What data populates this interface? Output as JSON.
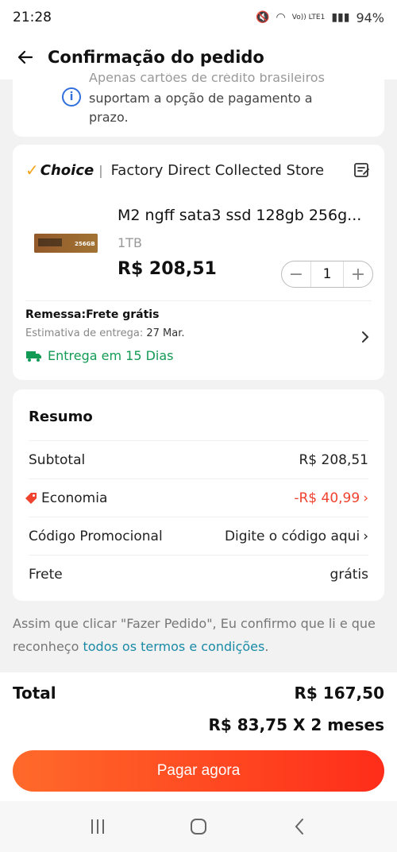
{
  "status_bar": {
    "time": "21:28",
    "network": "Vo)) LTE1",
    "battery": "94%"
  },
  "header": {
    "title": "Confirmação do pedido",
    "back_icon": "arrow-left-icon"
  },
  "notice": {
    "text_clipped": "Apenas cartões de crédito brasileiros",
    "text": "suportam a opção de pagamento a prazo.",
    "icon": "info-icon"
  },
  "store": {
    "badge": "Choice",
    "name": "Factory Direct Collected Store",
    "edit_icon": "note-edit-icon"
  },
  "product": {
    "title": "M2 ngff sata3 ssd 128gb 256g...",
    "variant": "1TB",
    "price": "R$ 208,51",
    "quantity": "1",
    "image_label": "256GB"
  },
  "shipping": {
    "label": "Remessa:Frete grátis",
    "estimate_label": "Estimativa de entrega:",
    "estimate_date": "27 Mar.",
    "delivery_days": "Entrega em 15 Dias"
  },
  "summary": {
    "title": "Resumo",
    "subtotal_label": "Subtotal",
    "subtotal_value": "R$ 208,51",
    "savings_label": "Economia",
    "savings_value": "-R$ 40,99",
    "promo_label": "Código Promocional",
    "promo_value": "Digite o código aqui",
    "freight_label": "Frete",
    "freight_value": "grátis"
  },
  "terms": {
    "text": "Assim que clicar \"Fazer Pedido\", Eu confirmo que li e que reconheço",
    "link": "todos os termos e condições",
    "end": "."
  },
  "footer": {
    "total_label": "Total",
    "total_value": "R$ 167,50",
    "installment": "R$ 83,75 X 2 meses",
    "pay_button": "Pagar agora"
  },
  "colors": {
    "accent": "#ff3d1f",
    "green": "#139a55",
    "red": "#f0432f",
    "link": "#1a8aa6"
  }
}
